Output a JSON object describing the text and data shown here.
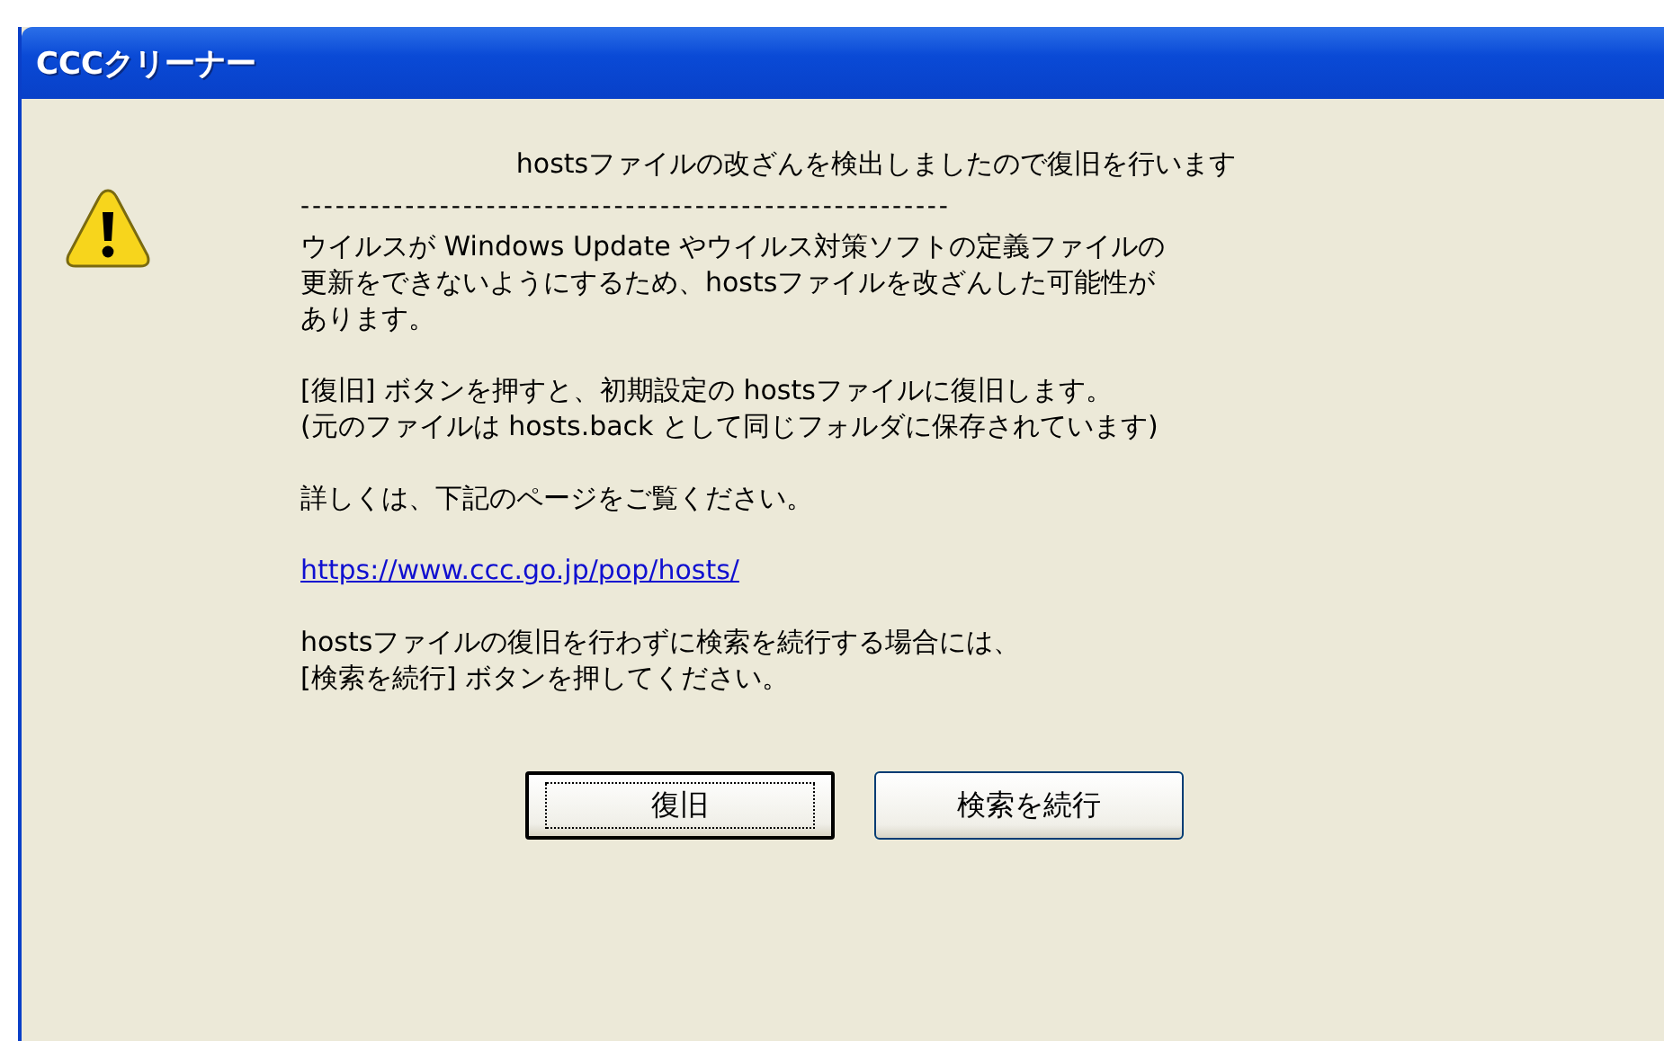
{
  "window": {
    "title": "CCCクリーナー"
  },
  "message": {
    "heading": "hostsファイルの改ざんを検出しましたので復旧を行います",
    "separator": "--------------------------------------------------------",
    "paragraphs": [
      {
        "kind": "text",
        "lines": [
          "ウイルスが Windows Update やウイルス対策ソフトの定義ファイルの",
          "更新をできないようにするため、hostsファイルを改ざんした可能性が",
          "あります。"
        ]
      },
      {
        "kind": "text",
        "lines": [
          "[復旧] ボタンを押すと、初期設定の hostsファイルに復旧します。",
          "(元のファイルは hosts.back として同じフォルダに保存されています)"
        ]
      },
      {
        "kind": "text",
        "lines": [
          "詳しくは、下記のページをご覧ください。"
        ]
      },
      {
        "kind": "link",
        "lines": [
          "https://www.ccc.go.jp/pop/hosts/"
        ]
      },
      {
        "kind": "text",
        "lines": [
          "hostsファイルの復旧を行わずに検索を続行する場合には、",
          "[検索を続行] ボタンを押してください。"
        ]
      }
    ]
  },
  "buttons": [
    {
      "label": "復旧",
      "focused": true
    },
    {
      "label": "検索を続行",
      "focused": false
    }
  ]
}
